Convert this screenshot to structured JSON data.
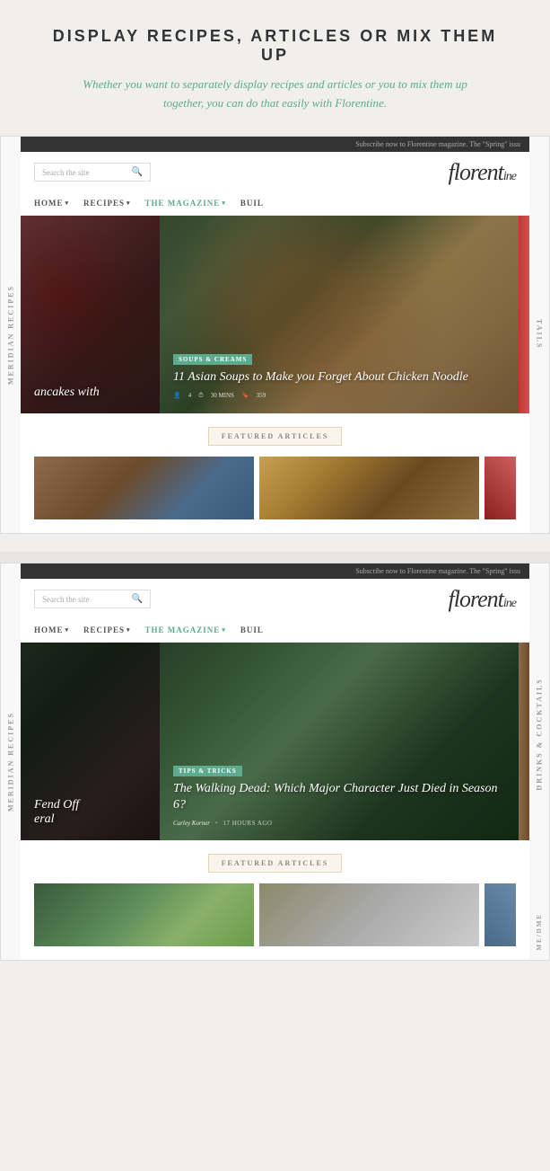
{
  "header": {
    "title": "DISPLAY RECIPES, ARTICLES OR MIX THEM UP",
    "subtitle": "Whether you want to separately display recipes and articles or you to mix them up together, you can do that easily with Florentine."
  },
  "site1": {
    "topbar": "Subscribe now to Florentine magazine. The \"Spring\" issu",
    "search_placeholder": "Search the site",
    "logo": "florent",
    "nav": [
      {
        "label": "HOME",
        "has_arrow": true,
        "active": false
      },
      {
        "label": "RECIPES",
        "has_arrow": true,
        "active": false
      },
      {
        "label": "THE MAGAZINE",
        "has_arrow": true,
        "active": true
      },
      {
        "label": "BUIL",
        "has_arrow": false,
        "active": false
      }
    ],
    "slide_left_title": "ancakes with",
    "slide_right_tag": "SOUPS & CREAMS",
    "slide_right_title": "11 Asian Soups to Make you Forget About Chicken Noodle",
    "slide_right_meta": {
      "servings": "4",
      "time": "30 MINS",
      "rating": "359"
    },
    "featured_label": "FEATURED ARTICLES",
    "sidebar_label": "MERIDIAN RECIPES"
  },
  "site2": {
    "topbar": "Subscribe now to Florentine magazine. The \"Spring\" issu",
    "search_placeholder": "Search the site",
    "logo": "florent",
    "nav": [
      {
        "label": "HOME",
        "has_arrow": true,
        "active": false
      },
      {
        "label": "RECIPES",
        "has_arrow": true,
        "active": false
      },
      {
        "label": "THE MAGAZINE",
        "has_arrow": true,
        "active": true
      },
      {
        "label": "BUIL",
        "has_arrow": false,
        "active": false
      }
    ],
    "slide_left_title1": "Fend Off",
    "slide_left_title2": "eral",
    "slide_right_tag": "TIPS & TRICKS",
    "slide_right_title": "The Walking Dead: Which Major Character Just Died in Season 6?",
    "author_name": "Carley Korner",
    "author_time": "17 HOURS AGO",
    "featured_label": "FEATURED ARTICLES",
    "sidebar_top": "MERIDIAN RECIPES",
    "sidebar_bottom": "DRINKS & COCKTAILS",
    "sidebar_mid": "ME/DME"
  }
}
